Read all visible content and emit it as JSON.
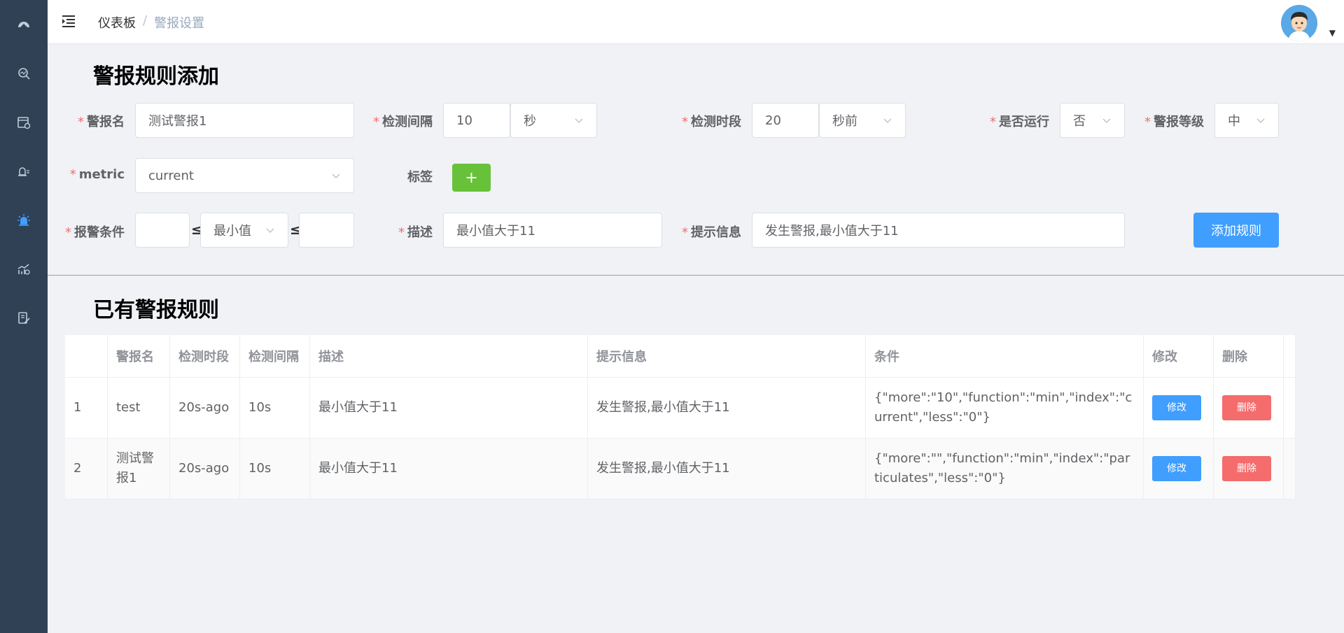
{
  "sidebar": {
    "items": [
      {
        "icon": "dashboard-icon"
      },
      {
        "icon": "monitor-search-icon"
      },
      {
        "icon": "data-settings-icon"
      },
      {
        "icon": "device-icon"
      },
      {
        "icon": "alarm-icon",
        "active": true
      },
      {
        "icon": "trend-chart-icon"
      },
      {
        "icon": "report-icon"
      }
    ],
    "active_color": "#409eff"
  },
  "header": {
    "breadcrumb": {
      "home": "仪表板",
      "separator": "/",
      "current": "警报设置"
    }
  },
  "form": {
    "title": "警报规则添加",
    "alarm_name": {
      "label": "警报名",
      "value": "测试警报1"
    },
    "interval": {
      "label": "检测间隔",
      "value": "10",
      "unit": "秒"
    },
    "period": {
      "label": "检测时段",
      "value": "20",
      "unit": "秒前"
    },
    "running": {
      "label": "是否运行",
      "value": "否"
    },
    "level": {
      "label": "警报等级",
      "value": "中"
    },
    "metric": {
      "label": "metric",
      "value": "current"
    },
    "tags": {
      "label": "标签",
      "add_button": "+"
    },
    "condition": {
      "label": "报警条件",
      "more": "",
      "function": "最小值",
      "less": "",
      "op": "≤"
    },
    "description": {
      "label": "描述",
      "value": "最小值大于11"
    },
    "message": {
      "label": "提示信息",
      "value": "发生警报,最小值大于11"
    },
    "submit_button": "添加规则"
  },
  "rules": {
    "title": "已有警报规则",
    "columns": [
      "",
      "警报名",
      "检测时段",
      "检测间隔",
      "描述",
      "提示信息",
      "条件",
      "修改",
      "删除"
    ],
    "rows": [
      {
        "index": "1",
        "name": "test",
        "period": "20s-ago",
        "interval": "10s",
        "description": "最小值大于11",
        "message": "发生警报,最小值大于11",
        "condition": "{\"more\":\"10\",\"function\":\"min\",\"index\":\"current\",\"less\":\"0\"}",
        "edit": "修改",
        "delete": "删除"
      },
      {
        "index": "2",
        "name": "测试警报1",
        "period": "20s-ago",
        "interval": "10s",
        "description": "最小值大于11",
        "message": "发生警报,最小值大于11",
        "condition": "{\"more\":\"\",\"function\":\"min\",\"index\":\"particulates\",\"less\":\"0\"}",
        "edit": "修改",
        "delete": "删除"
      }
    ]
  },
  "colors": {
    "primary": "#409eff",
    "success": "#67c23a",
    "danger": "#f56c6c",
    "sidebar": "#304156"
  }
}
